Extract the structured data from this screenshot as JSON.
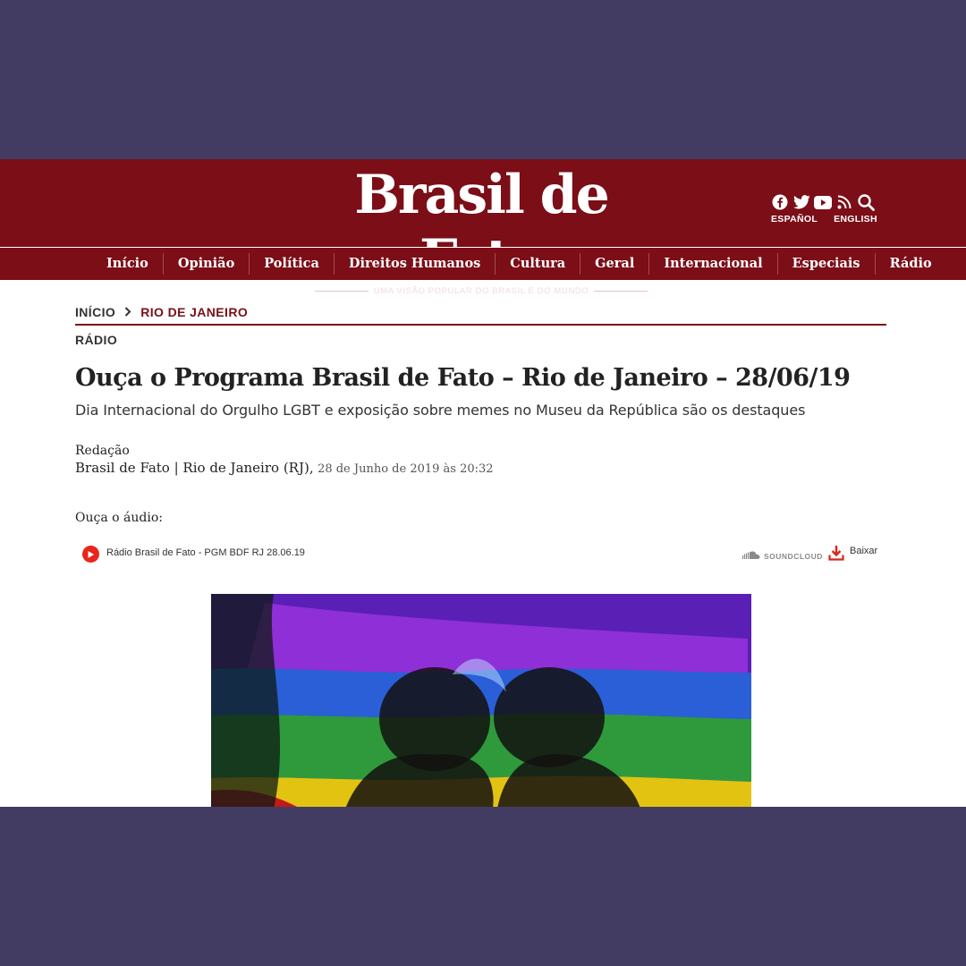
{
  "brand": {
    "logo": "Brasil de Fato",
    "tagline": "UMA VISÃO POPULAR DO BRASIL E DO MUNDO",
    "accent_color": "#7b0e17",
    "background_color": "#433c62"
  },
  "header": {
    "social_icons": [
      "facebook-icon",
      "twitter-icon",
      "youtube-icon",
      "rss-icon",
      "search-icon"
    ],
    "languages": [
      "ESPAÑOL",
      "ENGLISH"
    ]
  },
  "nav": {
    "items": [
      "Início",
      "Opinião",
      "Política",
      "Direitos Humanos",
      "Cultura",
      "Geral",
      "Internacional",
      "Especiais",
      "Rádio"
    ]
  },
  "breadcrumb": {
    "home": "INÍCIO",
    "current": "RIO DE JANEIRO"
  },
  "article": {
    "section": "RÁDIO",
    "title": "Ouça o Programa Brasil de Fato – Rio de Janeiro – 28/06/19",
    "subtitle": "Dia Internacional do Orgulho LGBT e exposição sobre memes no Museu da República são os destaques",
    "author": "Redação",
    "source": "Brasil de Fato | Rio de Janeiro (RJ),",
    "date": "28 de Junho de 2019 às 20:32",
    "audio_label": "Ouça o áudio:"
  },
  "player": {
    "track": "Rádio Brasil de Fato - PGM BDF RJ 28.06.19",
    "soundcloud_label": "SOUNDCLOUD",
    "download_label": "Baixar",
    "play_color": "#e8251a"
  },
  "photo": {
    "icon": "rainbow-flag-photo"
  }
}
